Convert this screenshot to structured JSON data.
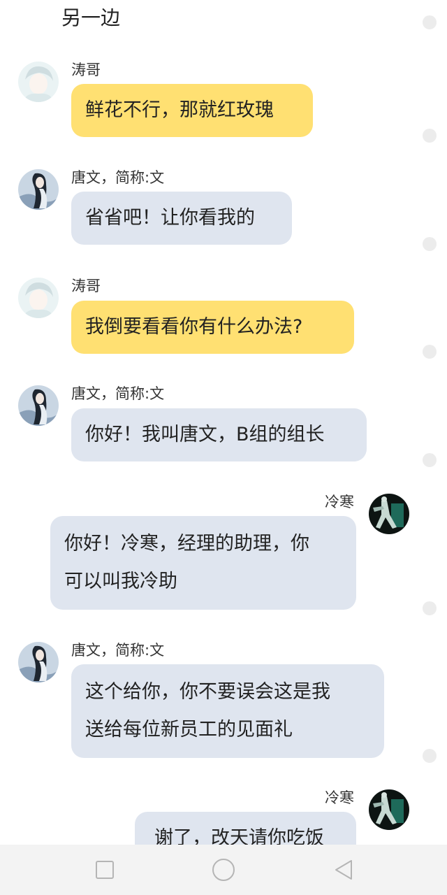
{
  "header": {
    "title": "另一边"
  },
  "messages": [
    {
      "sender": "涛哥",
      "side": "left",
      "style": "yellow",
      "lines": [
        "鲜花不行，那就红玫瑰"
      ]
    },
    {
      "sender": "唐文，简称:文",
      "side": "left",
      "style": "gray",
      "lines": [
        "省省吧！让你看我的"
      ]
    },
    {
      "sender": "涛哥",
      "side": "left",
      "style": "yellow",
      "lines": [
        "我倒要看看你有什么办法?"
      ]
    },
    {
      "sender": "唐文，简称:文",
      "side": "left",
      "style": "gray",
      "lines": [
        "你好！我叫唐文，B组的组长"
      ]
    },
    {
      "sender": "冷寒",
      "side": "right",
      "style": "gray",
      "lines": [
        "你好！冷寒，经理的助理，你",
        "可以叫我冷助"
      ]
    },
    {
      "sender": "唐文，简称:文",
      "side": "left",
      "style": "gray",
      "lines": [
        "这个给你，你不要误会这是我",
        "送给每位新员工的见面礼"
      ]
    },
    {
      "sender": "冷寒",
      "side": "right",
      "style": "gray",
      "lines": [
        "谢了，改天请你吃饭"
      ]
    }
  ],
  "colors": {
    "yellow_bubble": "#ffe072",
    "gray_bubble": "#dfe5ef"
  },
  "navbar": {
    "icons": [
      "square-icon",
      "circle-icon",
      "back-triangle-icon"
    ]
  }
}
